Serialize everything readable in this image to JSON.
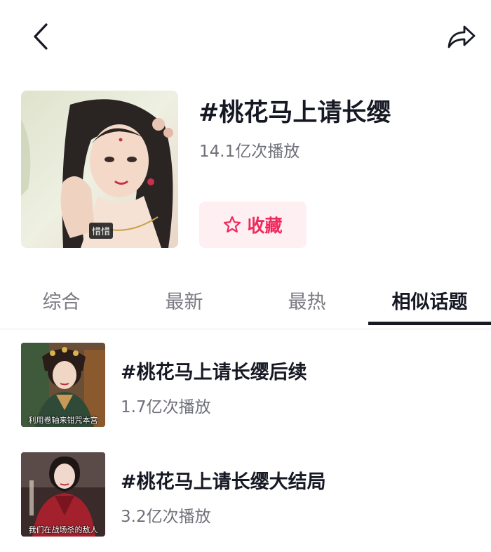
{
  "header": {
    "back_icon": "chevron-left-icon",
    "share_icon": "share-arrow-icon"
  },
  "topic": {
    "title": "#桃花马上请长缨",
    "views": "14.1亿次播放",
    "cover_tag": "惜惜",
    "favorite_label": "收藏",
    "favorite_icon": "star-outline-icon",
    "accent_color": "#f0285b"
  },
  "tabs": [
    {
      "label": "综合"
    },
    {
      "label": "最新"
    },
    {
      "label": "最热"
    },
    {
      "label": "相似话题",
      "active": true
    }
  ],
  "related": [
    {
      "title": "#桃花马上请长缨后续",
      "views": "1.7亿次播放",
      "thumb_caption": "利用卷轴来钳咒本宫"
    },
    {
      "title": "#桃花马上请长缨大结局",
      "views": "3.2亿次播放",
      "thumb_caption": "我们在战场杀的敌人"
    }
  ]
}
